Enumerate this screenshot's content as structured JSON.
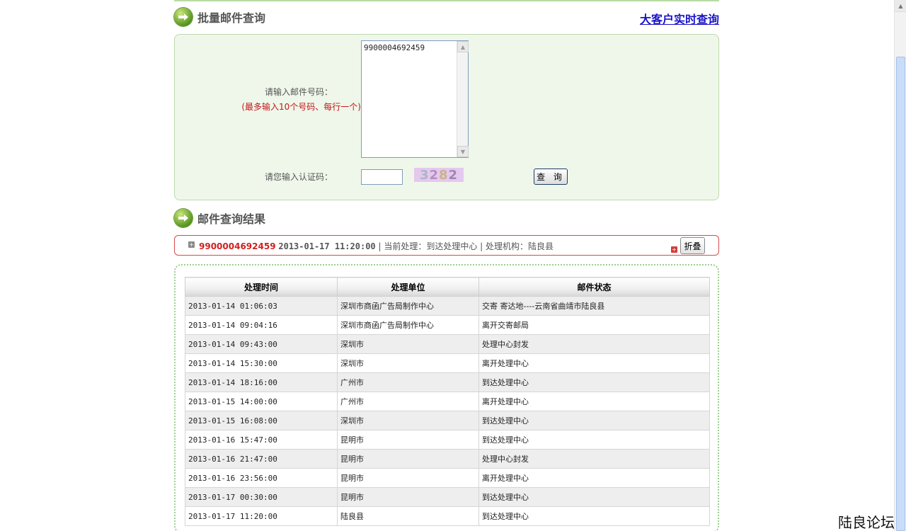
{
  "header": {
    "section_title": "批量邮件查询",
    "bigclient_link": "大客户实时查询"
  },
  "query": {
    "mail_label": "请输入邮件号码：",
    "mail_note": "(最多输入10个号码、每行一个)",
    "mail_value": "9900004692459",
    "code_label": "请您输入认证码：",
    "code_value": "",
    "captcha": [
      "3",
      "2",
      "8",
      "2"
    ],
    "query_button": "查 询"
  },
  "results": {
    "section_title": "邮件查询结果",
    "summary": {
      "mail_no": "9900004692459",
      "datetime": "2013-01-17 11:20:00",
      "current": "| 当前处理：到达处理中心",
      "org": "| 处理机构：陆良县"
    },
    "fold_button": "折叠",
    "columns": [
      "处理时间",
      "处理单位",
      "邮件状态"
    ],
    "rows": [
      [
        "2013-01-14 01:06:03",
        "深圳市商函广告局制作中心",
        "交寄 寄达地----云南省曲靖市陆良县"
      ],
      [
        "2013-01-14 09:04:16",
        "深圳市商函广告局制作中心",
        "离开交寄邮局"
      ],
      [
        "2013-01-14 09:43:00",
        "深圳市",
        "处理中心封发"
      ],
      [
        "2013-01-14 15:30:00",
        "深圳市",
        "离开处理中心"
      ],
      [
        "2013-01-14 18:16:00",
        "广州市",
        "到达处理中心"
      ],
      [
        "2013-01-15 14:00:00",
        "广州市",
        "离开处理中心"
      ],
      [
        "2013-01-15 16:08:00",
        "深圳市",
        "到达处理中心"
      ],
      [
        "2013-01-16 15:47:00",
        "昆明市",
        "到达处理中心"
      ],
      [
        "2013-01-16 21:47:00",
        "昆明市",
        "处理中心封发"
      ],
      [
        "2013-01-16 23:56:00",
        "昆明市",
        "离开处理中心"
      ],
      [
        "2013-01-17 00:30:00",
        "昆明市",
        "到达处理中心"
      ],
      [
        "2013-01-17 11:20:00",
        "陆良县",
        "到达处理中心"
      ]
    ]
  },
  "watermark": "陆良论坛",
  "colors": {
    "panel_bg": "#eff7ea",
    "accent_green": "#4f8f1a",
    "link_blue": "#1a13c9",
    "alert_red": "#d02020"
  }
}
